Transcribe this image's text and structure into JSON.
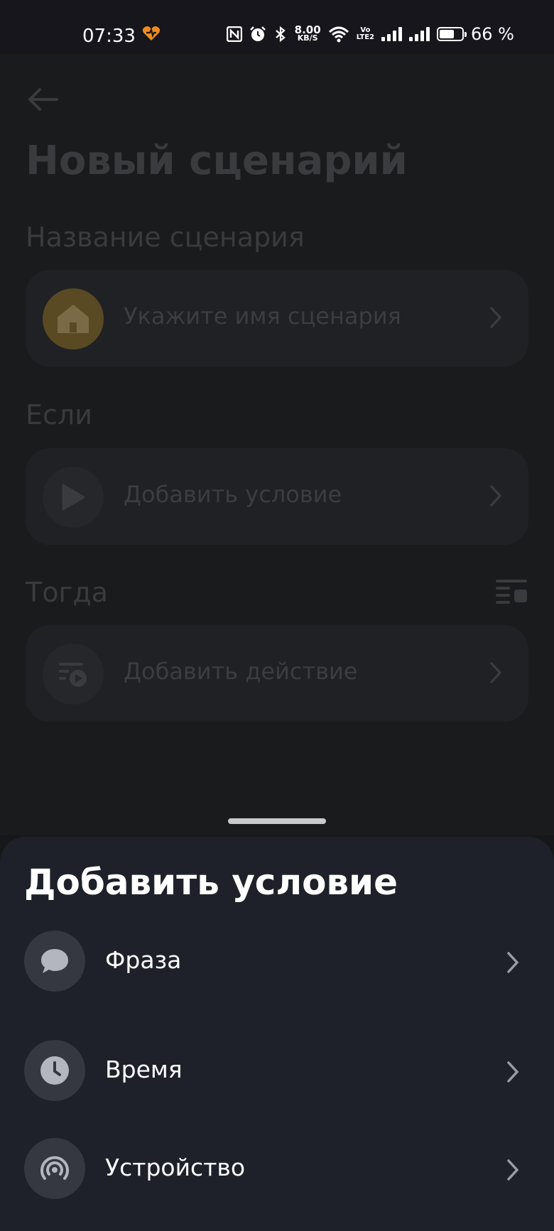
{
  "status_bar": {
    "time": "07:33",
    "net_speed_value": "8.00",
    "net_speed_unit": "KB/S",
    "volte_top": "Vo",
    "volte_bottom": "LTE2",
    "battery_percent": "66 %",
    "battery_level": 0.66
  },
  "screen": {
    "title": "Новый сценарий",
    "name_section": {
      "label": "Название сценария",
      "placeholder": "Укажите имя сценария"
    },
    "if_section": {
      "label": "Если",
      "card_label": "Добавить условие"
    },
    "then_section": {
      "label": "Тогда",
      "card_label": "Добавить действие"
    }
  },
  "sheet": {
    "title": "Добавить условие",
    "options": [
      {
        "label": "Фраза",
        "icon": "chat-bubble-icon"
      },
      {
        "label": "Время",
        "icon": "clock-icon"
      },
      {
        "label": "Устройство",
        "icon": "device-signal-icon"
      }
    ]
  },
  "colors": {
    "home_icon_bg": "#5a4a23",
    "sheet_bg": "#1f212a",
    "option_icon_bg": "#363841"
  }
}
